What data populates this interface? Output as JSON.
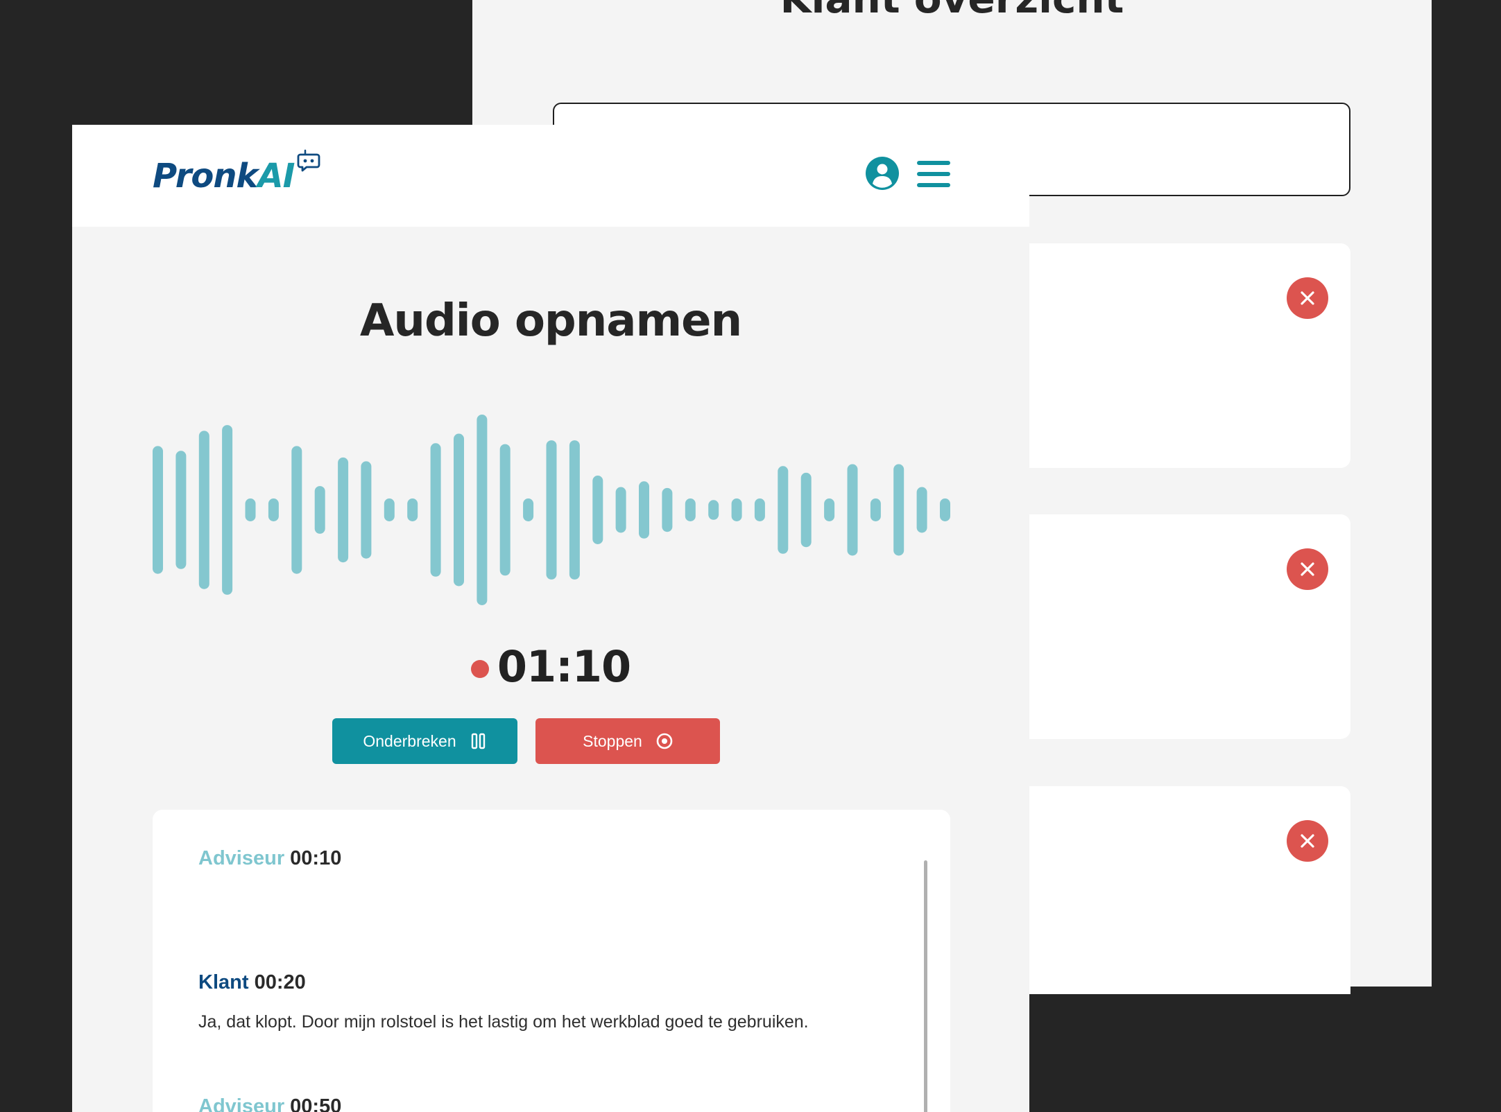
{
  "background_window": {
    "title": "Klant overzicht",
    "cards": [
      {
        "close_label": "×"
      },
      {
        "close_label": "×"
      },
      {
        "close_label": "×"
      }
    ]
  },
  "app": {
    "logo": {
      "part1": "Pronk",
      "part2": "AI"
    },
    "page_title": "Audio opnamen",
    "timer": "01:10",
    "buttons": {
      "pause_label": "Onderbreken",
      "stop_label": "Stoppen"
    },
    "waveform_levels": [
      0.67,
      0.62,
      0.83,
      0.89,
      0.12,
      0.12,
      0.67,
      0.25,
      0.55,
      0.51,
      0.12,
      0.12,
      0.7,
      0.8,
      1.0,
      0.69,
      0.12,
      0.73,
      0.73,
      0.36,
      0.24,
      0.3,
      0.23,
      0.12,
      0.1,
      0.12,
      0.12,
      0.46,
      0.39,
      0.12,
      0.48,
      0.12,
      0.48,
      0.24,
      0.12
    ],
    "transcript": [
      {
        "speaker": "Adviseur",
        "time": "00:10",
        "text": ""
      },
      {
        "speaker": "Klant",
        "time": "00:20",
        "text": "Ja, dat klopt. Door mijn rolstoel is het lastig om het werkblad goed te gebruiken."
      },
      {
        "speaker": "Adviseur",
        "time": "00:50",
        "text": ""
      }
    ]
  },
  "colors": {
    "teal": "#10919f",
    "wave": "#84c7cf",
    "red": "#dc544f",
    "navy": "#0e4a80",
    "dark_bg": "#252525"
  }
}
